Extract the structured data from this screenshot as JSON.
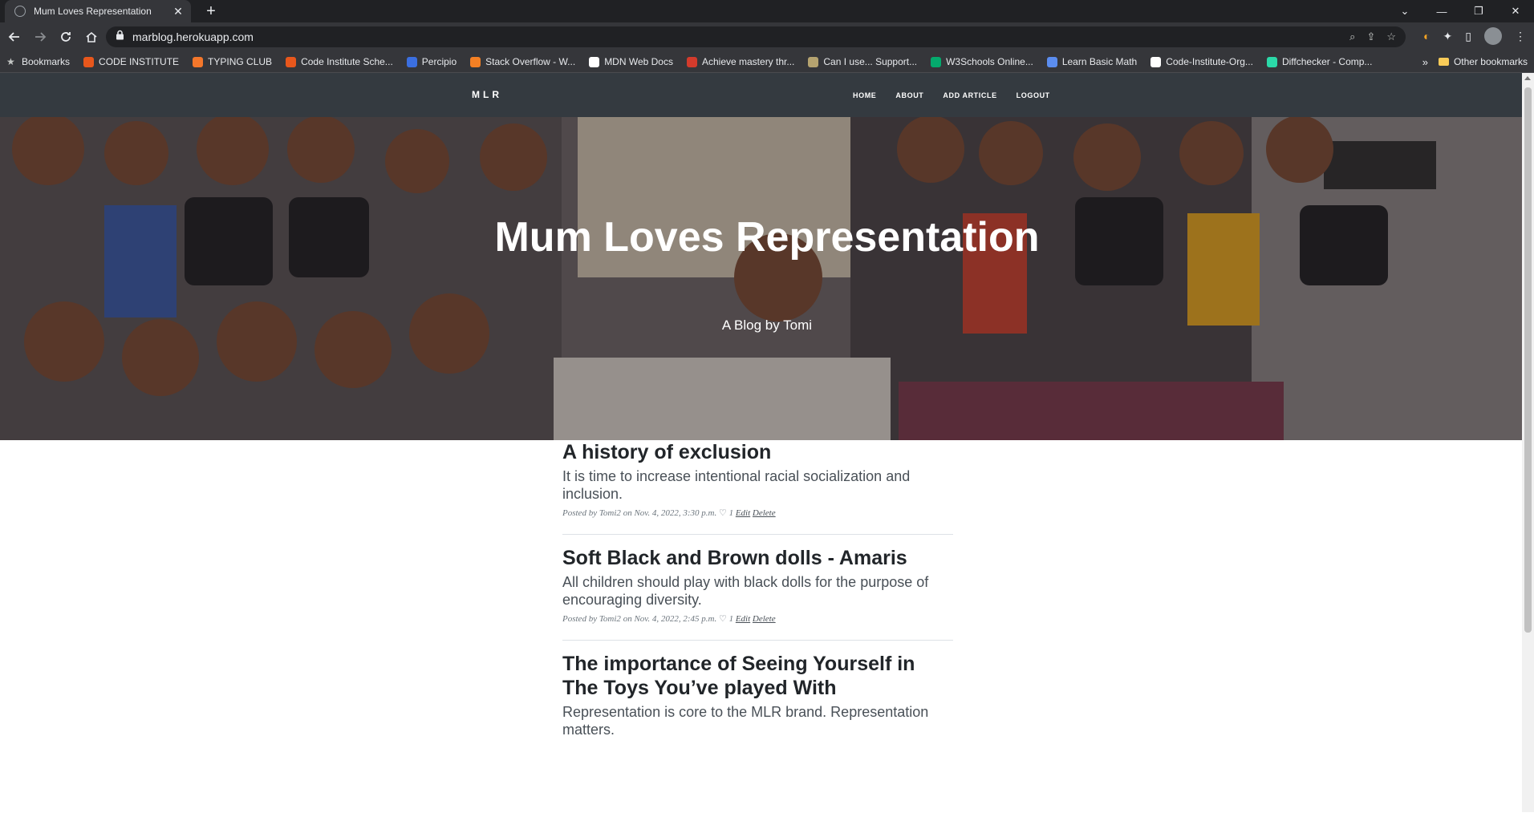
{
  "browser": {
    "tab_title": "Mum Loves Representation",
    "url": "marblog.herokuapp.com",
    "bookmarks": [
      {
        "label": "Bookmarks",
        "icon": "star-icon",
        "color": "#c4c7c5"
      },
      {
        "label": "CODE INSTITUTE",
        "icon": "code-institute-icon",
        "color": "#e8571c"
      },
      {
        "label": "TYPING CLUB",
        "icon": "typing-club-icon",
        "color": "#f4772b"
      },
      {
        "label": "Code Institute Sche...",
        "icon": "code-institute-icon",
        "color": "#e8571c"
      },
      {
        "label": "Percipio",
        "icon": "percipio-icon",
        "color": "#3b6fe0"
      },
      {
        "label": "Stack Overflow - W...",
        "icon": "stack-overflow-icon",
        "color": "#f48024"
      },
      {
        "label": "MDN Web Docs",
        "icon": "mdn-icon",
        "color": "#ffffff"
      },
      {
        "label": "Achieve mastery thr...",
        "icon": "achieve-icon",
        "color": "#d33b2c"
      },
      {
        "label": "Can I use... Support...",
        "icon": "caniuse-icon",
        "color": "#b5a370"
      },
      {
        "label": "W3Schools Online...",
        "icon": "w3schools-icon",
        "color": "#04aa6d"
      },
      {
        "label": "Learn Basic Math",
        "icon": "pi-icon",
        "color": "#5b8def"
      },
      {
        "label": "Code-Institute-Org...",
        "icon": "github-icon",
        "color": "#ffffff"
      },
      {
        "label": "Diffchecker - Comp...",
        "icon": "diffchecker-icon",
        "color": "#2bd9a8"
      }
    ],
    "more_bookmarks": "»",
    "other_bookmarks": "Other bookmarks"
  },
  "site": {
    "brand": "MLR",
    "nav": [
      "HOME",
      "ABOUT",
      "ADD ARTICLE",
      "LOGOUT"
    ],
    "hero_title": "Mum Loves Representation",
    "hero_subtitle": "A Blog by Tomi"
  },
  "posts": [
    {
      "title": "A history of exclusion",
      "subtitle": "It is time to increase intentional racial socialization and inclusion.",
      "posted_by": "Posted by",
      "author": "Tomi2",
      "date": "on Nov. 4, 2022, 3:30 p.m.",
      "likes": "1",
      "edit": "Edit",
      "delete": "Delete"
    },
    {
      "title": "Soft Black and Brown dolls - Amaris",
      "subtitle": "All children should play with black dolls for the purpose of encouraging diversity.",
      "posted_by": "Posted by",
      "author": "Tomi2",
      "date": "on Nov. 4, 2022, 2:45 p.m.",
      "likes": "1",
      "edit": "Edit",
      "delete": "Delete"
    },
    {
      "title": "The importance of Seeing Yourself in The Toys You’ve played With",
      "subtitle": "Representation is core to the MLR brand. Representation matters."
    }
  ]
}
